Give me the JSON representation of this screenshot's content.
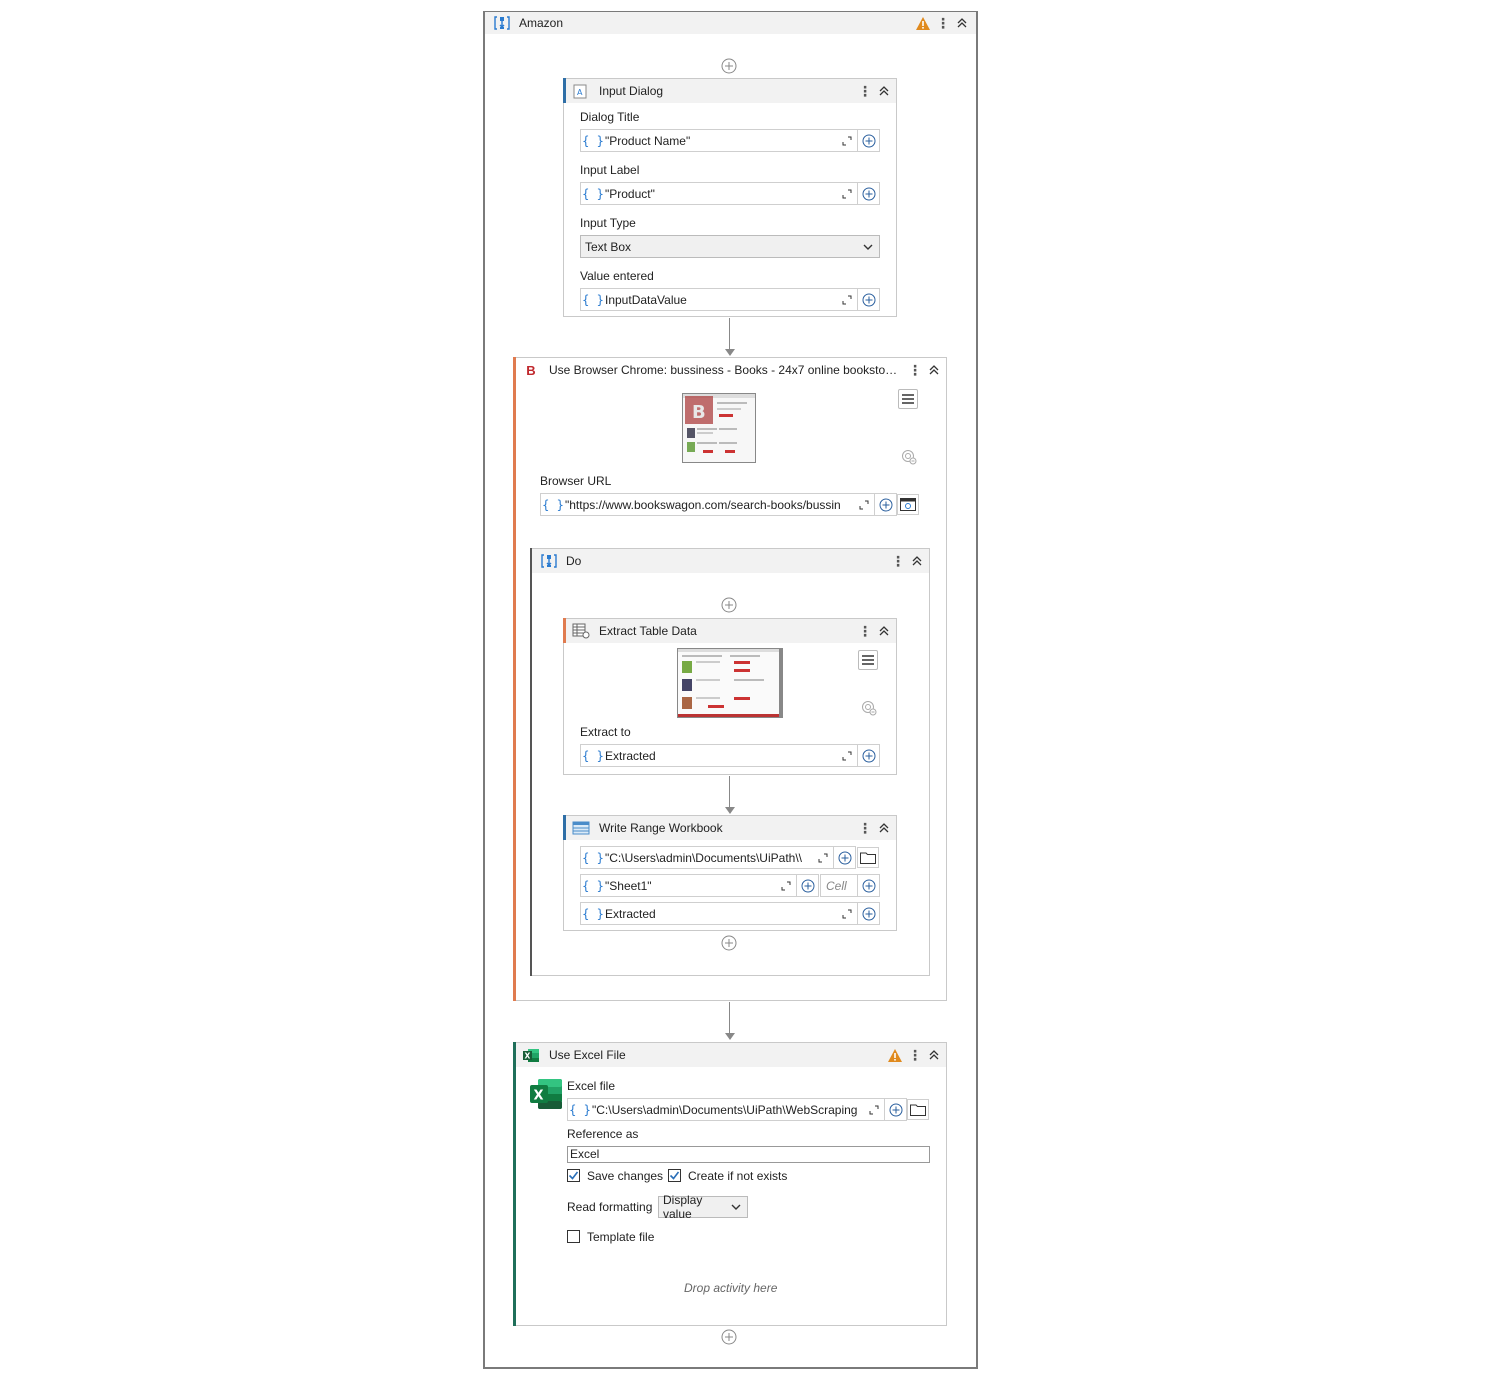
{
  "sequence": {
    "title": "Amazon",
    "warning": true
  },
  "input_dialog": {
    "title": "Input Dialog",
    "dialog_title_label": "Dialog Title",
    "dialog_title_value": "\"Product Name\"",
    "input_label_label": "Input Label",
    "input_label_value": "\"Product\"",
    "input_type_label": "Input Type",
    "input_type_value": "Text Box",
    "value_entered_label": "Value entered",
    "value_entered_value": "InputDataValue"
  },
  "use_browser": {
    "title": "Use Browser Chrome: bussiness - Books - 24x7 online bookstore...",
    "browser_url_label": "Browser URL",
    "browser_url_value": "\"https://www.bookswagon.com/search-books/bussin"
  },
  "do_block": {
    "title": "Do"
  },
  "extract_table": {
    "title": "Extract Table Data",
    "extract_to_label": "Extract to",
    "extract_to_value": "Extracted"
  },
  "write_range": {
    "title": "Write Range Workbook",
    "path_value": "\"C:\\Users\\admin\\Documents\\UiPath\\\\",
    "sheet_value": "\"Sheet1\"",
    "cell_placeholder": "Cell",
    "data_value": "Extracted"
  },
  "use_excel": {
    "title": "Use Excel File",
    "warning": true,
    "excel_file_label": "Excel file",
    "excel_file_value": "\"C:\\Users\\admin\\Documents\\UiPath\\WebScraping",
    "reference_label": "Reference as",
    "reference_value": "Excel",
    "save_changes_label": "Save changes",
    "save_changes_checked": true,
    "create_if_not_exists_label": "Create if not exists",
    "create_if_not_exists_checked": true,
    "read_formatting_label": "Read formatting",
    "read_formatting_value": "Display value",
    "template_file_label": "Template file",
    "template_file_checked": false,
    "drop_placeholder": "Drop activity here"
  },
  "icons": {
    "brace": "{ }",
    "sequence": "sequence-icon",
    "input_dialog": "input-dialog-icon",
    "browser": "browser-b-icon",
    "extract": "extract-table-icon",
    "write_range": "write-range-icon",
    "excel": "excel-icon"
  },
  "colors": {
    "browser_accent": "#e07b4f",
    "excel_accent": "#1f6f5a",
    "input_accent": "#2f6fa7",
    "warning": "#e08a1e",
    "brace_blue": "#2a7bd0"
  }
}
